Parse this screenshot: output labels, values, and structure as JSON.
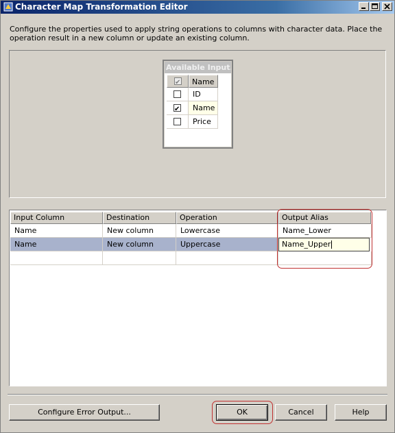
{
  "window": {
    "title": "Character Map Transformation Editor",
    "controls": [
      "minimize",
      "maximize",
      "close"
    ]
  },
  "description": "Configure the properties used to apply string operations to columns with character data. Place the operation result in a new column or update an existing column.",
  "available_inputs": {
    "title": "Available Input...",
    "header": {
      "checked": true,
      "name_label": "Name"
    },
    "columns": [
      {
        "name": "ID",
        "checked": false
      },
      {
        "name": "Name",
        "checked": true
      },
      {
        "name": "Price",
        "checked": false
      }
    ]
  },
  "grid": {
    "headers": {
      "input_column": "Input Column",
      "destination": "Destination",
      "operation": "Operation",
      "output_alias": "Output Alias"
    },
    "rows": [
      {
        "input_column": "Name",
        "destination": "New column",
        "operation": "Lowercase",
        "output_alias": "Name_Lower"
      },
      {
        "input_column": "Name",
        "destination": "New column",
        "operation": "Uppercase",
        "output_alias": "Name_Upper"
      }
    ],
    "editing_value": "Name_Upper"
  },
  "buttons": {
    "configure_error_output": "Configure Error Output...",
    "ok": "OK",
    "cancel": "Cancel",
    "help": "Help"
  },
  "highlight_color": "#c03030",
  "selected_row_color": "#a8b2cc"
}
